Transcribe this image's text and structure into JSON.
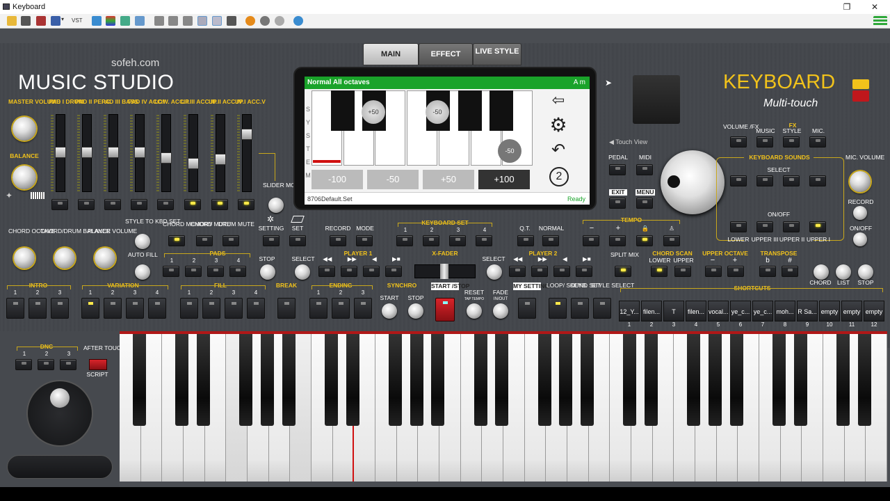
{
  "window": {
    "title": "Keyboard"
  },
  "brand": {
    "site": "sofeh.com",
    "name": "MUSIC STUDIO",
    "product": "KEYBOARD",
    "subtitle": "Multi-touch"
  },
  "tabs": [
    {
      "label": "MAIN"
    },
    {
      "label": "EFFECT"
    },
    {
      "label": "LIVE STYLE"
    }
  ],
  "mixer": {
    "master": "MASTER VOLUME",
    "balance": "BALANCE",
    "channels": [
      {
        "label": "PAD I DRUM"
      },
      {
        "label": "PAD II PERC."
      },
      {
        "label": "PAD III BASS"
      },
      {
        "label": "PAD IV ACC.I"
      },
      {
        "label": "LOW. ACC.II"
      },
      {
        "label": "UP.III ACC.III"
      },
      {
        "label": "UP.II ACC.IV"
      },
      {
        "label": "UP.I ACC.V"
      }
    ],
    "slider_mode": "SLIDER MODE",
    "setting": "SETTING",
    "set": "SET"
  },
  "display": {
    "header": "Normal All octaves",
    "chord": "A m",
    "letters": [
      "S",
      "Y",
      "S",
      "T",
      "E",
      "M"
    ],
    "bubbles": [
      "+50",
      "-50",
      "-50"
    ],
    "buttons": [
      "-100",
      "-50",
      "+50",
      "+100"
    ],
    "file": "8706Default.Set",
    "status": "Ready",
    "page": "2"
  },
  "right": {
    "touch_view": "Touch View",
    "pedal": "PEDAL",
    "midi": "MIDI",
    "exit": "EXIT",
    "menu": "MENU",
    "volume_fx": "VOLUME /FX",
    "fx": "FX",
    "fx_music": "MUSIC",
    "fx_style": "STYLE",
    "fx_mic": "MIC.",
    "keyboard_sounds": "KEYBOARD SOUNDS",
    "select": "SELECT",
    "onoff": "ON/OFF",
    "lower": "LOWER",
    "upper3": "UPPER III",
    "upper2": "UPPER II",
    "upper1": "UPPER I",
    "mic_volume": "MIC. VOLUME",
    "record": "RECORD",
    "mic_onoff": "ON/OFF"
  },
  "row2": {
    "chord_octave": "CHORD OCTAVE",
    "chord_drum_balance": "CHORD/DRUM BALANCE",
    "player_volume": "PLAYER VOLUME",
    "style_to_kbd": "STYLE TO KBD SET",
    "chord_memory": "CHORD MEMORY",
    "chord_mute": "CHORD MUTE",
    "drum_mute": "DRUM MUTE",
    "record": "RECORD",
    "mode": "MODE",
    "keyboard_set": "KEYBOARD SET",
    "kbset_nums": [
      "1",
      "2",
      "3",
      "4"
    ],
    "qt": "Q.T.",
    "normal": "NORMAL",
    "tempo": "TEMPO",
    "tempo_minus": "−",
    "tempo_plus": "+"
  },
  "row3": {
    "auto_fill": "AUTO FILL",
    "pads": "PADS",
    "pad_nums": [
      "1",
      "2",
      "3",
      "4"
    ],
    "stop": "STOP",
    "player1": "PLAYER 1",
    "select": "SELECT",
    "xfader": "X-FADER",
    "player2": "PLAYER 2",
    "select2": "SELECT",
    "split_mix": "SPLIT MIX",
    "chord_scan": "CHORD SCAN",
    "cs_lower": "LOWER",
    "cs_upper": "UPPER",
    "upper_octave": "UPPER OCTAVE",
    "uo_minus": "−",
    "uo_plus": "+",
    "transpose": "TRANSPOSE",
    "tr_flat": "b",
    "tr_sharp": "#",
    "chord": "CHORD",
    "list": "LIST",
    "stop2": "STOP"
  },
  "row4": {
    "intro": "INTRO",
    "variation": "VARIATION",
    "fill": "FILL",
    "break": "BREAK",
    "ending": "ENDING",
    "synchro": "SYNCHRO",
    "start": "START",
    "stop": "STOP",
    "start_stop": "START /STOP",
    "reset": "RESET",
    "tap_tempo": "TAP TEMPO",
    "fade": "FADE",
    "in_out": "IN/OUT",
    "my_setting": "MY SETTING",
    "loop_sound": "LOOP/ SOUND",
    "keyb_set": "KEYB. SET",
    "style_select": "STYLE SELECT",
    "shortcuts": "SHORTCUTS",
    "nums3": [
      "1",
      "2",
      "3"
    ],
    "nums4": [
      "1",
      "2",
      "3",
      "4"
    ]
  },
  "shortcuts": [
    {
      "label": "12_Y...",
      "num": "1"
    },
    {
      "label": "filen...",
      "num": "2"
    },
    {
      "label": "T",
      "num": "3"
    },
    {
      "label": "filen...",
      "num": "4"
    },
    {
      "label": "vocal...",
      "num": "5"
    },
    {
      "label": "ye_c...",
      "num": "6"
    },
    {
      "label": "ye_c...",
      "num": "7"
    },
    {
      "label": "moh...",
      "num": "8"
    },
    {
      "label": "R Sa...",
      "num": "9"
    },
    {
      "label": "empty",
      "num": "10"
    },
    {
      "label": "empty",
      "num": "11"
    },
    {
      "label": "empty",
      "num": "12"
    }
  ],
  "lower": {
    "dnc": "DNC",
    "dnc_nums": [
      "1",
      "2",
      "3"
    ],
    "after_touch": "AFTER TOUCH",
    "script": "SCRIPT"
  },
  "colors": {
    "accent": "#f1c21b",
    "display_header": "#1aa32a",
    "record": "#c0171c",
    "play_line": "#d01010"
  }
}
